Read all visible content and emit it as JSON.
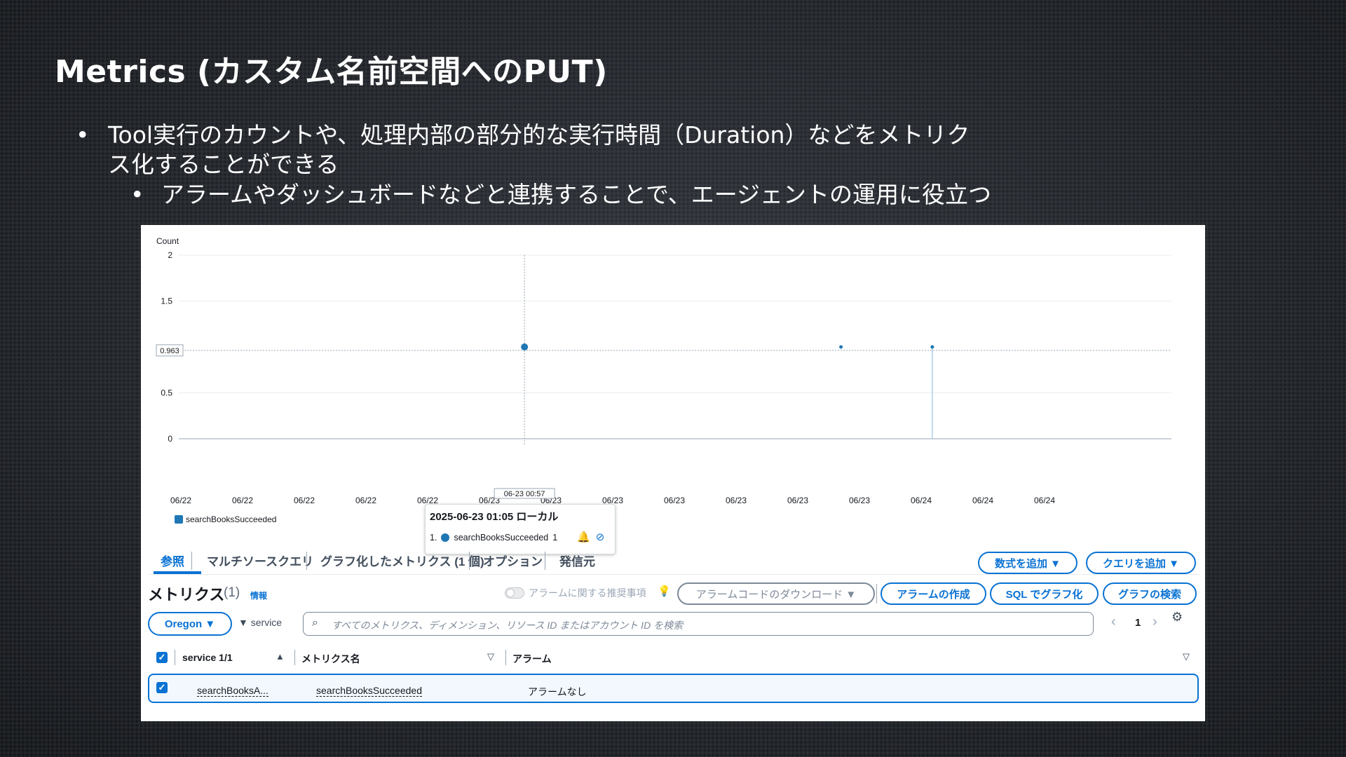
{
  "slide": {
    "title": "Metrics (カスタム名前空間へのPUT)",
    "bullets": [
      "Tool実行のカウントや、処理内部の部分的な実行時間（Duration）などをメトリクス化することができる",
      "アラームやダッシュボードなどと連携することで、エージェントの運用に役立つ"
    ],
    "bullet_marker": "•"
  },
  "chart_data": {
    "type": "line",
    "ylabel": "Count",
    "y_ticks": [
      "0",
      "0.5",
      "1.5",
      "2"
    ],
    "ylim": [
      0,
      2
    ],
    "threshold_label": "0.963",
    "x_tick_labels": [
      "06/22",
      "06/22",
      "06/22",
      "06/22",
      "06/22",
      "06/23",
      "06/23",
      "06/23",
      "06/23",
      "06/23",
      "06/23",
      "06/23",
      "06/24",
      "06/24",
      "06/24"
    ],
    "series": [
      {
        "name": "searchBooksSucceeded",
        "color": "#1f77b4",
        "points": [
          {
            "x_index": 5.57,
            "y": 1
          },
          {
            "x_index": 10.7,
            "y": 1
          },
          {
            "x_index": 12.18,
            "y": 1
          }
        ]
      }
    ],
    "cursor_label": "06-23 00:57",
    "grid": true
  },
  "tooltip": {
    "time": "2025-06-23 01:05 ローカル",
    "row": "1.",
    "series_name": "searchBooksSucceeded",
    "value": "1"
  },
  "tabs": [
    "参照",
    "マルチソースクエリ",
    "グラフ化したメトリクス (1 個)",
    "オプション",
    "発信元"
  ],
  "buttons": {
    "add_math": "数式を追加 ▼",
    "add_query": "クエリを追加 ▼",
    "alarm_code_download": "アラームコードのダウンロード ▼",
    "create_alarm": "アラームの作成",
    "graph_with_sql": "SQL でグラフ化",
    "browse_graphs": "グラフの検索",
    "region": "Oregon ▼"
  },
  "metrics_panel": {
    "title": "メトリクス",
    "count": "(1)",
    "info": "情報",
    "toggle_label": "アラームに関する推奨事項",
    "filter_chip": "▼ service",
    "search_placeholder": "すべてのメトリクス、ディメンション、リソース ID またはアカウント ID を検索",
    "page": "1"
  },
  "table": {
    "headers": {
      "service": "service 1/1",
      "metric": "メトリクス名",
      "alarm": "アラーム"
    },
    "rows": [
      {
        "service": "searchBooksA...",
        "metric": "searchBooksSucceeded",
        "alarm": "アラームなし"
      }
    ]
  }
}
